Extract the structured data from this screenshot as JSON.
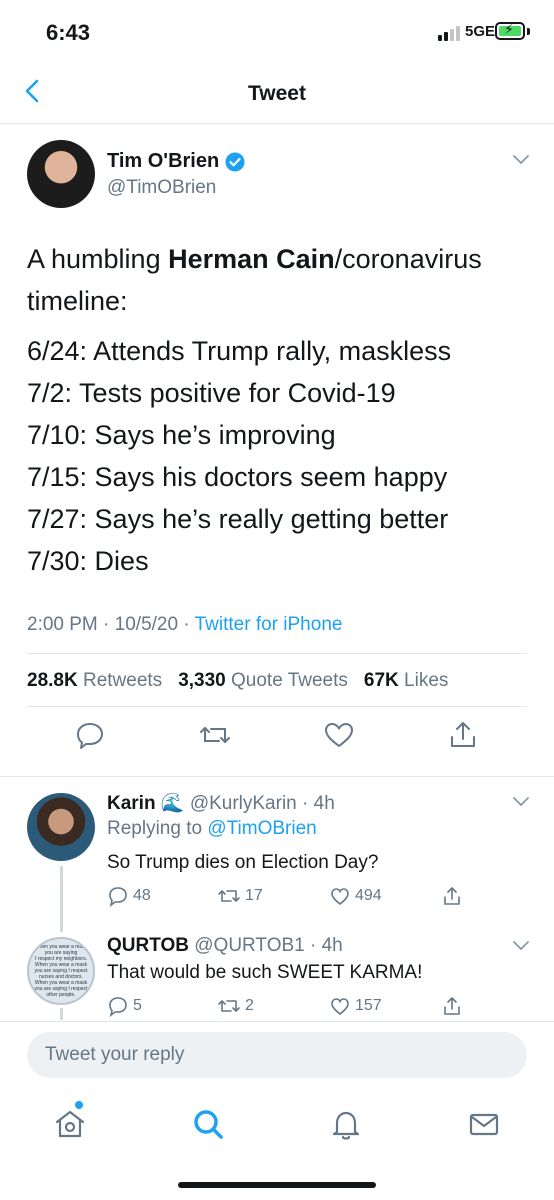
{
  "status_bar": {
    "time": "6:43",
    "network": "5GE",
    "battery_color": "#4cd964"
  },
  "header": {
    "title": "Tweet",
    "back_icon": "chevron-left-icon"
  },
  "tweet": {
    "author_name": "Tim O'Brien",
    "author_handle": "@TimOBrien",
    "verified": true,
    "text_pre": "A humbling ",
    "text_bold": "Herman Cain",
    "text_post": "/coronavirus timeline:",
    "timeline": [
      "6/24: Attends Trump rally, maskless",
      "7/2: Tests positive for Covid-19",
      "7/10: Says he’s improving",
      "7/15: Says his doctors seem happy",
      "7/27: Says he’s really getting better",
      "7/30: Dies"
    ],
    "time": "2:00 PM",
    "date": "10/5/20",
    "separator": "·",
    "via": "Twitter for iPhone",
    "stats": {
      "retweets_count": "28.8K",
      "retweets_label": "Retweets",
      "quotes_count": "3,330",
      "quotes_label": "Quote Tweets",
      "likes_count": "67K",
      "likes_label": "Likes"
    }
  },
  "replies": [
    {
      "name": "Karin",
      "emoji": "🌊",
      "handle": "@KurlyKarin",
      "time": "· 4h",
      "replying_label": "Replying to",
      "replying_to": "@TimOBrien",
      "text": "So Trump dies on Election Day?",
      "replies": "48",
      "retweets": "17",
      "likes": "494"
    },
    {
      "name": "QURTOB",
      "handle": "@QURTOB1",
      "time": "· 4h",
      "text": "That would be such SWEET KARMA!",
      "replies": "5",
      "retweets": "2",
      "likes": "157",
      "avatar_text": [
        "When you wear a mask",
        "you are saying",
        "I respect my neighbors.",
        "When you wear a mask",
        "you are saying I respect",
        "nurses and doctors.",
        "When you wear a mask",
        "you are saying I respect",
        "other people."
      ]
    }
  ],
  "compose": {
    "placeholder": "Tweet your reply"
  },
  "tabbar": {
    "items": [
      "home-icon",
      "search-icon",
      "notifications-icon",
      "messages-icon"
    ],
    "accent": "#1da1f2"
  }
}
